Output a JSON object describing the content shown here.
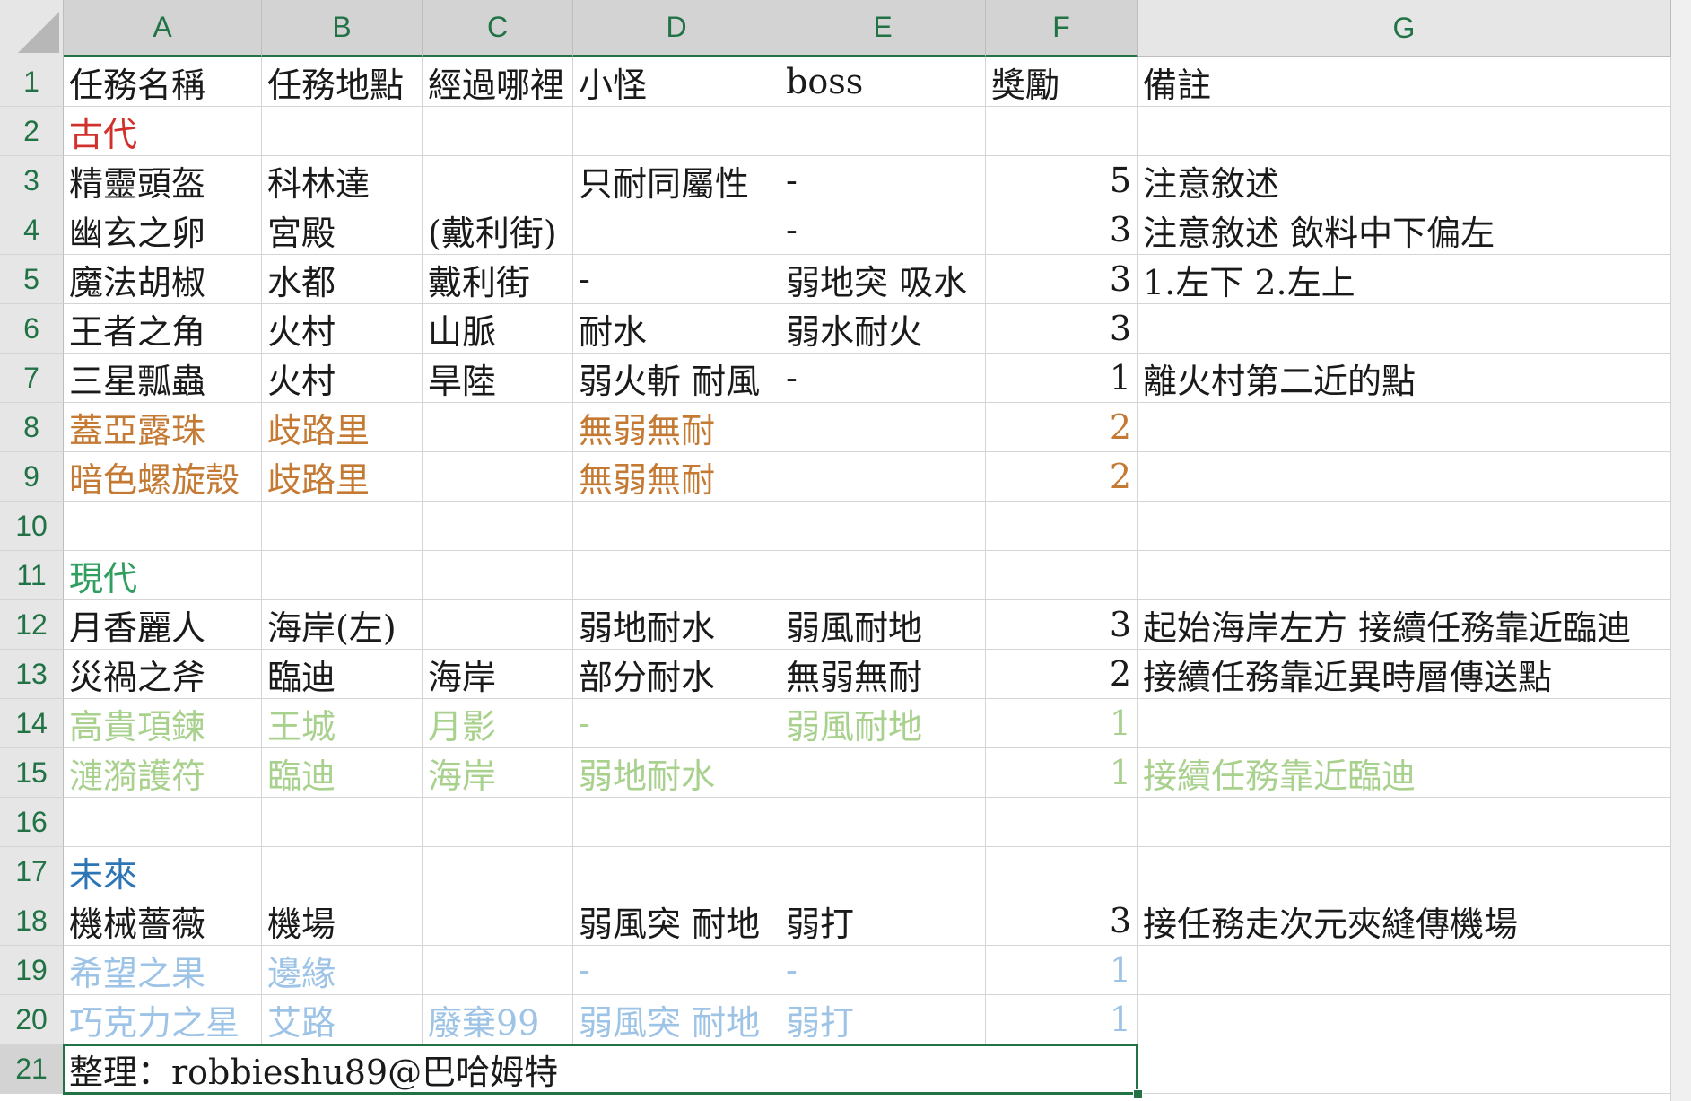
{
  "columns": [
    "A",
    "B",
    "C",
    "D",
    "E",
    "F",
    "G"
  ],
  "selected_columns": [
    "A",
    "B",
    "C",
    "D",
    "E",
    "F"
  ],
  "selected_row": "21",
  "rows": [
    {
      "n": "1",
      "cells": [
        "任務名稱",
        "任務地點",
        "經過哪裡",
        "小怪",
        "boss",
        "獎勵",
        "備註"
      ],
      "color": "#1a1a1a"
    },
    {
      "n": "2",
      "cells": [
        "古代",
        "",
        "",
        "",
        "",
        "",
        ""
      ],
      "color": "#d0312d"
    },
    {
      "n": "3",
      "cells": [
        "精靈頭盔",
        "科林達",
        "",
        "只耐同屬性",
        "-",
        "5",
        "注意敘述"
      ],
      "color": "#1a1a1a"
    },
    {
      "n": "4",
      "cells": [
        "幽玄之卵",
        "宮殿",
        "(戴利街)",
        "",
        "-",
        "3",
        "注意敘述 飲料中下偏左"
      ],
      "color": "#1a1a1a"
    },
    {
      "n": "5",
      "cells": [
        "魔法胡椒",
        "水都",
        "戴利街",
        "-",
        "弱地突 吸水",
        "3",
        "1.左下 2.左上"
      ],
      "color": "#1a1a1a"
    },
    {
      "n": "6",
      "cells": [
        "王者之角",
        "火村",
        "山脈",
        "耐水",
        "弱水耐火",
        "3",
        ""
      ],
      "color": "#1a1a1a"
    },
    {
      "n": "7",
      "cells": [
        "三星瓢蟲",
        "火村",
        "旱陸",
        "弱火斬 耐風",
        "-",
        "1",
        "離火村第二近的點"
      ],
      "color": "#1a1a1a"
    },
    {
      "n": "8",
      "cells": [
        "蓋亞露珠",
        "歧路里",
        "",
        "無弱無耐",
        "",
        "2",
        ""
      ],
      "color": "#c57a34"
    },
    {
      "n": "9",
      "cells": [
        "暗色螺旋殼",
        "歧路里",
        "",
        "無弱無耐",
        "",
        "2",
        ""
      ],
      "color": "#c57a34"
    },
    {
      "n": "10",
      "cells": [
        "",
        "",
        "",
        "",
        "",
        "",
        ""
      ],
      "color": "#1a1a1a"
    },
    {
      "n": "11",
      "cells": [
        "現代",
        "",
        "",
        "",
        "",
        "",
        ""
      ],
      "color": "#2f9e5f"
    },
    {
      "n": "12",
      "cells": [
        "月香麗人",
        "海岸(左)",
        "",
        "弱地耐水",
        "弱風耐地",
        "3",
        "起始海岸左方 接續任務靠近臨迪"
      ],
      "color": "#1a1a1a"
    },
    {
      "n": "13",
      "cells": [
        "災禍之斧",
        "臨迪",
        "海岸",
        "部分耐水",
        "無弱無耐",
        "2",
        "接續任務靠近異時層傳送點"
      ],
      "color": "#1a1a1a"
    },
    {
      "n": "14",
      "cells": [
        "高貴項鍊",
        "王城",
        "月影",
        "-",
        "弱風耐地",
        "1",
        ""
      ],
      "color": "#a9d18e"
    },
    {
      "n": "15",
      "cells": [
        "漣漪護符",
        "臨迪",
        "海岸",
        "弱地耐水",
        "",
        "1",
        "接續任務靠近臨迪"
      ],
      "color": "#a9d18e"
    },
    {
      "n": "16",
      "cells": [
        "",
        "",
        "",
        "",
        "",
        "",
        ""
      ],
      "color": "#1a1a1a"
    },
    {
      "n": "17",
      "cells": [
        "未來",
        "",
        "",
        "",
        "",
        "",
        ""
      ],
      "color": "#2e75b6"
    },
    {
      "n": "18",
      "cells": [
        "機械薔薇",
        "機場",
        "",
        "弱風突 耐地",
        "弱打",
        "3",
        "接任務走次元夾縫傳機場"
      ],
      "color": "#1a1a1a"
    },
    {
      "n": "19",
      "cells": [
        "希望之果",
        "邊緣",
        "",
        "-",
        "-",
        "1",
        ""
      ],
      "color": "#9dc3e6"
    },
    {
      "n": "20",
      "cells": [
        "巧克力之星",
        "艾路",
        "廢棄99",
        "弱風突 耐地",
        "弱打",
        "1",
        ""
      ],
      "color": "#9dc3e6"
    },
    {
      "n": "21",
      "cells": [
        "整理：robbieshu89@巴哈姆特",
        "",
        "",
        "",
        "",
        "",
        ""
      ],
      "color": "#1a1a1a"
    }
  ]
}
